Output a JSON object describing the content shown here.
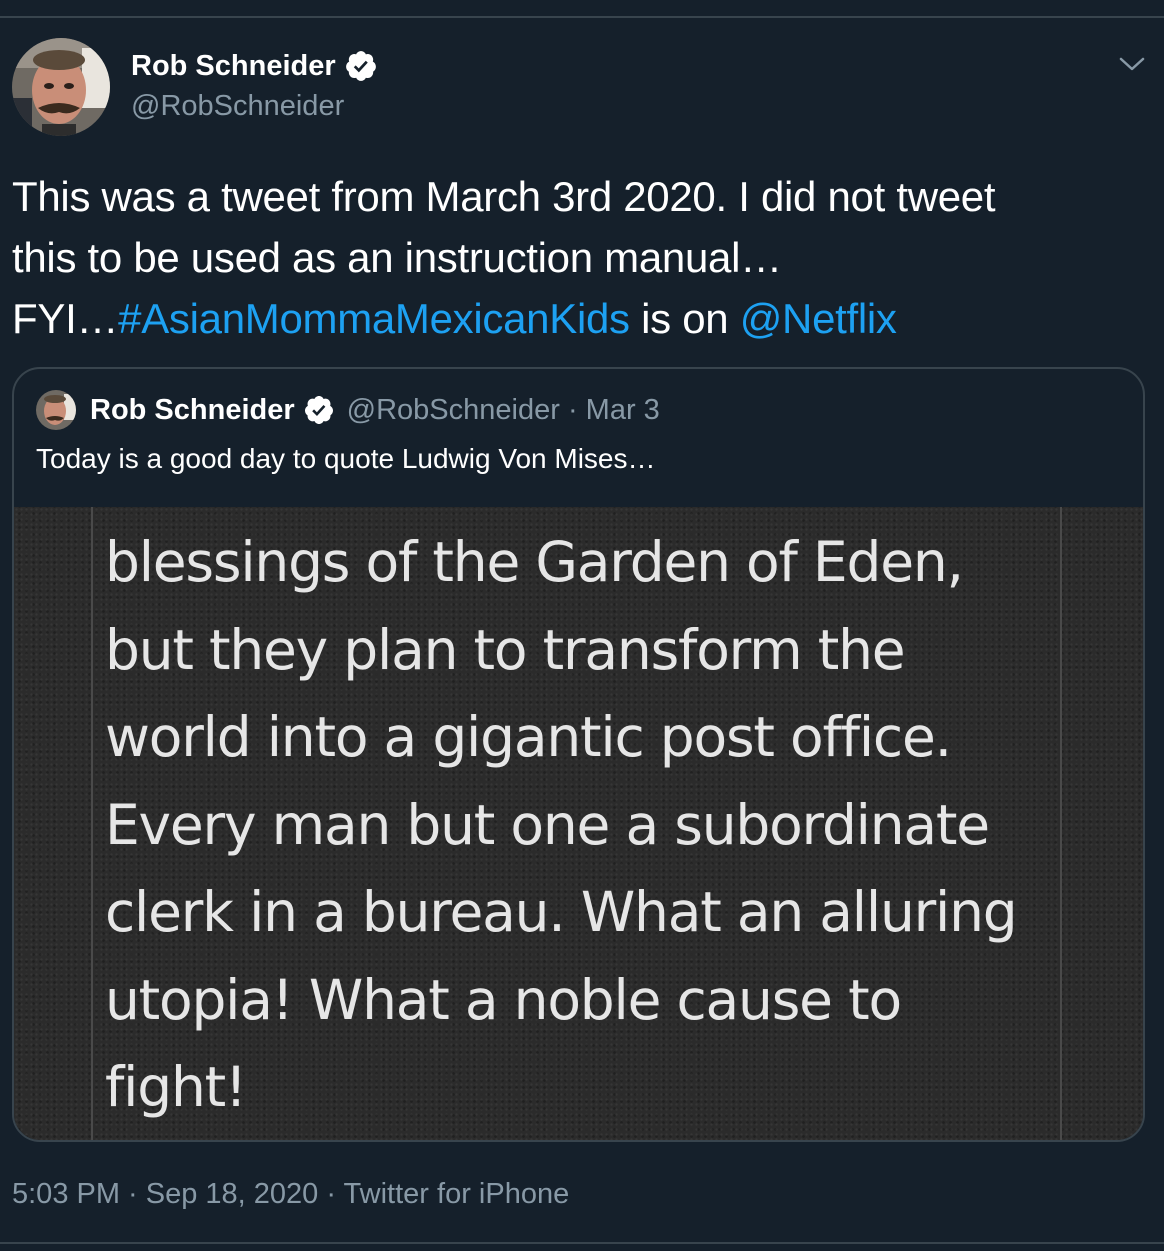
{
  "tweet": {
    "author": {
      "name": "Rob Schneider",
      "handle": "@RobSchneider"
    },
    "text_lines": [
      "This was a tweet from March 3rd 2020. I did not tweet",
      "this to be used as an instruction manual…"
    ],
    "text_prefix": "FYI…",
    "hashtag": "#AsianMommaMexicanKids",
    "text_mid": " is on ",
    "mention": "@Netflix",
    "timestamp": "5:03 PM · Sep 18, 2020 · Twitter for iPhone"
  },
  "quoted_tweet": {
    "name": "Rob Schneider",
    "handle": "@RobSchneider",
    "date_sep": " · ",
    "date": "Mar 3",
    "text": "Today is a good day to quote Ludwig Von Mises…",
    "image_text_lines": [
      "blessings of the Garden of Eden,",
      "but they plan to transform the",
      "world into a gigantic post office.",
      "Every man but one a subordinate",
      "clerk in a bureau. What an alluring",
      "utopia! What a noble cause to",
      "fight!"
    ]
  },
  "icons": {
    "verified": "verified-badge-icon",
    "caret": "chevron-down-icon"
  },
  "colors": {
    "background": "#15202b",
    "link": "#1da1f2",
    "secondary_text": "#8899a6",
    "border": "#38444d"
  }
}
